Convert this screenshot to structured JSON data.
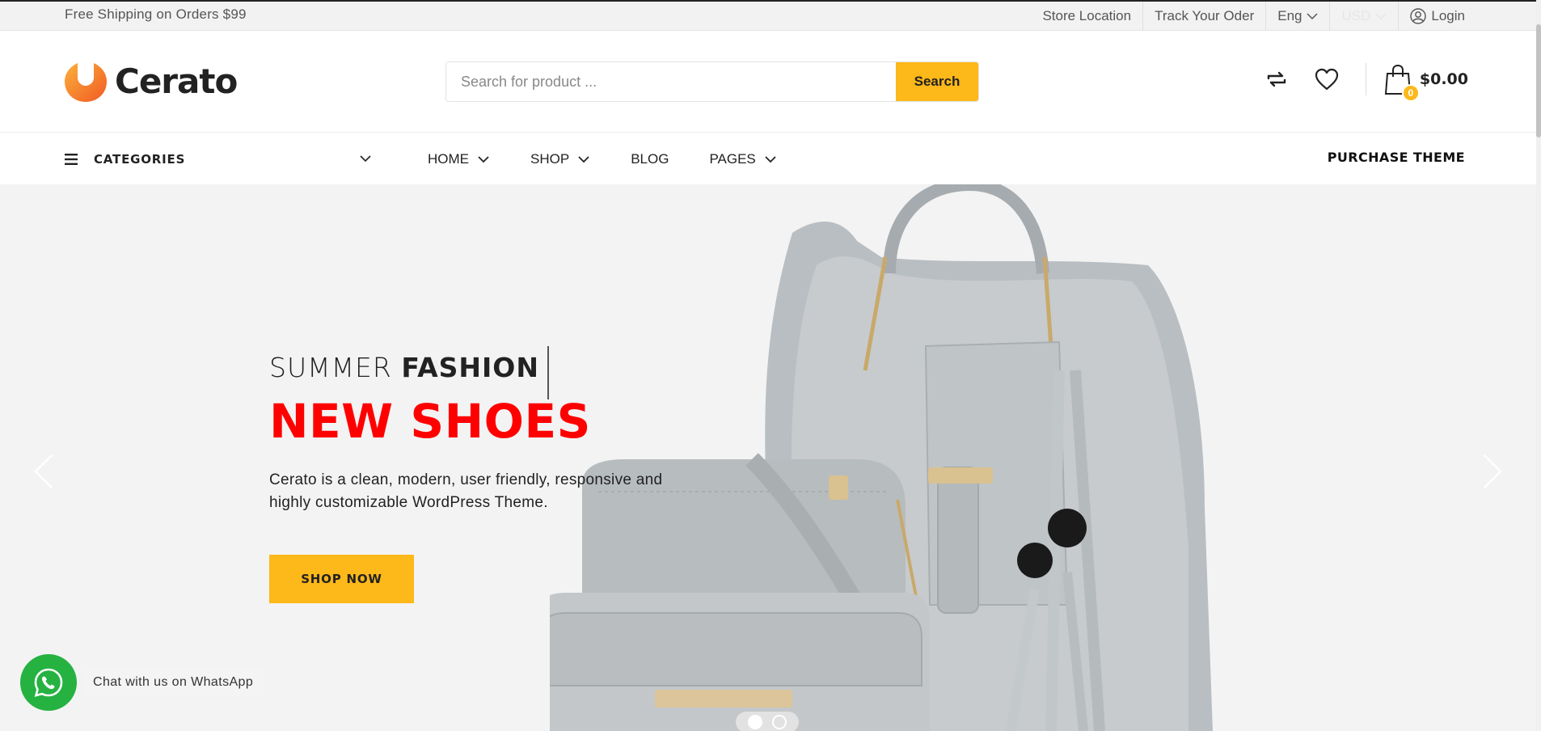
{
  "topbar": {
    "promo": "Free Shipping on Orders $99",
    "store_location": "Store Location",
    "track_order": "Track Your Oder",
    "language": "Eng",
    "currency": "USD",
    "login": "Login"
  },
  "header": {
    "logo_text": "Cerato",
    "search_placeholder": "Search for product ...",
    "search_button": "Search",
    "cart_count": "0",
    "cart_total": "$0.00"
  },
  "nav": {
    "categories": "CATEGORIES",
    "items": [
      {
        "label": "HOME"
      },
      {
        "label": "SHOP"
      },
      {
        "label": "BLOG"
      },
      {
        "label": "PAGES"
      }
    ],
    "purchase": "PURCHASE THEME"
  },
  "hero": {
    "eyebrow_light": "SUMMER",
    "eyebrow_bold": "FASHION",
    "title": "NEW SHOES",
    "description": "Cerato is a clean, modern, user friendly, responsive and highly customizable WordPress Theme.",
    "button": "SHOP NOW"
  },
  "whatsapp": {
    "label": "Chat with us on WhatsApp"
  },
  "colors": {
    "accent": "#fdb819",
    "headline": "#ff0000",
    "logo_orange": "#f7941d",
    "whatsapp": "#25b241",
    "hero_bg": "#f3f3f3"
  },
  "icons": [
    "user-icon",
    "compare-icon",
    "heart-icon",
    "bag-icon",
    "menu-icon",
    "chevron-down-icon",
    "chevron-left-icon",
    "chevron-right-icon",
    "whatsapp-icon"
  ]
}
